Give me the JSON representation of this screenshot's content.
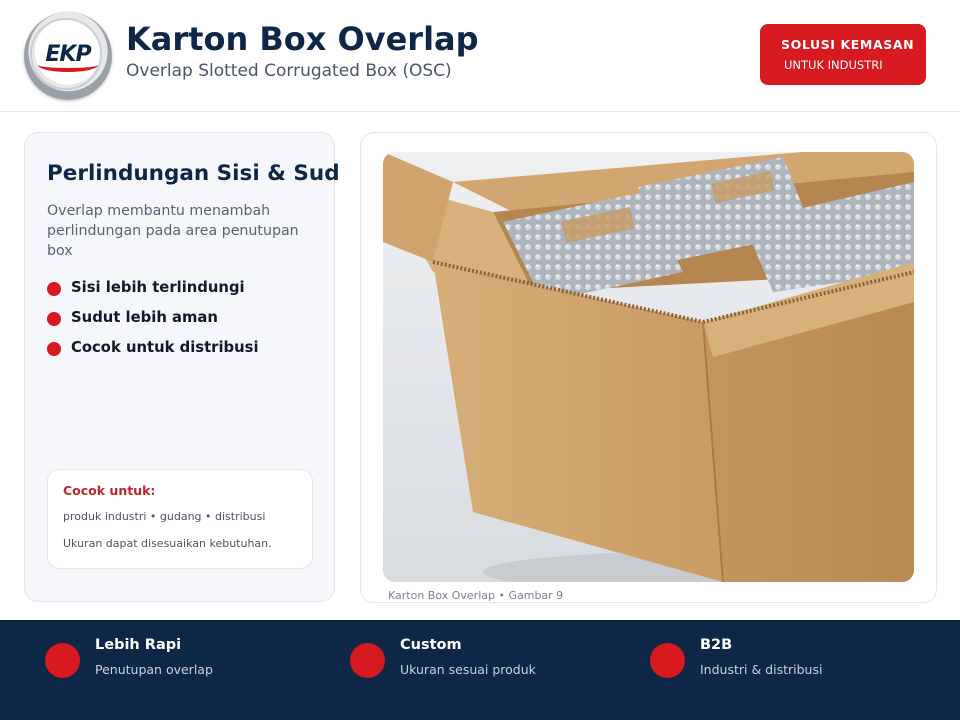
{
  "header": {
    "title": "Karton Box Overlap",
    "subtitle": "Overlap Slotted Corrugated Box (OSC)",
    "logo_text": "EKP",
    "badge_line1": "SOLUSI KEMASAN",
    "badge_line2": "UNTUK INDUSTRI"
  },
  "left_card": {
    "heading": "Perlindungan Sisi & Sud",
    "description": "Overlap membantu menambah perlindungan pada area penutupan box",
    "bullets": [
      "Sisi lebih terlindungi",
      "Sudut lebih aman",
      "Cocok untuk distribusi"
    ],
    "note": {
      "title": "Cocok untuk:",
      "list": "produk industri • gudang • distribusi",
      "size": "Ukuran dapat disesuaikan kebutuhan."
    }
  },
  "image": {
    "caption": "Karton Box Overlap • Gambar 9"
  },
  "footer": {
    "features": [
      {
        "title": "Lebih Rapi",
        "subtitle": "Penutupan overlap"
      },
      {
        "title": "Custom",
        "subtitle": "Ukuran sesuai produk"
      },
      {
        "title": "B2B",
        "subtitle": "Industri & distribusi"
      }
    ]
  },
  "colors": {
    "navy": "#0f2747",
    "accent_red": "#d71920",
    "card_bg": "#f5f7fb"
  }
}
